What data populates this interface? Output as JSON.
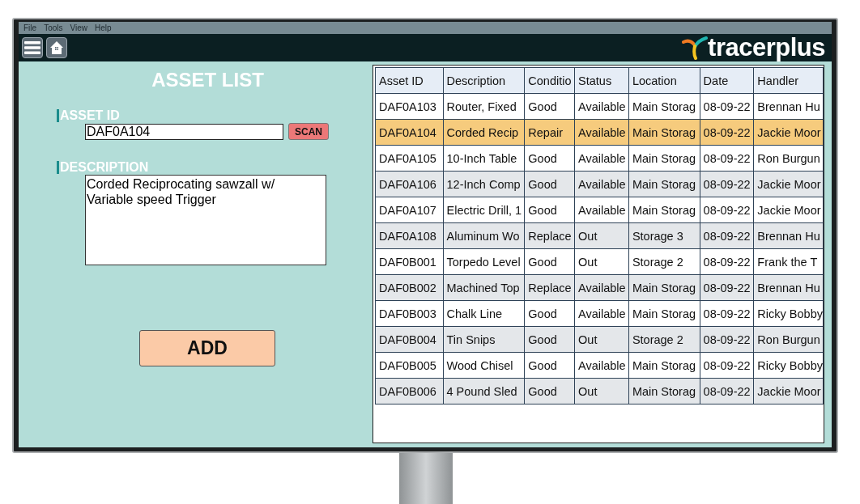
{
  "menu": [
    {
      "label": "File"
    },
    {
      "label": "Tools"
    },
    {
      "label": "View"
    },
    {
      "label": "Help"
    }
  ],
  "header": {
    "logo": "tracerplus"
  },
  "form": {
    "title": "ASSET LIST",
    "asset_id": {
      "label": "ASSET ID",
      "value": "DAF0A104"
    },
    "scan_button": "SCAN",
    "description": {
      "label": "DESCRIPTION",
      "value": "Corded Reciprocating sawzall w/ Variable speed Trigger"
    },
    "add_button": "ADD"
  },
  "table": {
    "columns": [
      "Asset ID",
      "Description",
      "Conditio",
      "Status",
      "Location",
      "Date",
      "Handler"
    ],
    "rows": [
      {
        "selected": false,
        "cells": [
          "DAF0A103",
          "Router, Fixed",
          "Good",
          "Available",
          "Main Storag",
          "08-09-22",
          "Brennan Hu"
        ]
      },
      {
        "selected": true,
        "cells": [
          "DAF0A104",
          "Corded Recip",
          "Repair",
          "Available",
          "Main Storag",
          "08-09-22",
          "Jackie Moor"
        ]
      },
      {
        "selected": false,
        "cells": [
          "DAF0A105",
          "10-Inch Table",
          "Good",
          "Available",
          "Main Storag",
          "08-09-22",
          "Ron Burgun"
        ]
      },
      {
        "selected": false,
        "cells": [
          "DAF0A106",
          "12-Inch Comp",
          "Good",
          "Available",
          "Main Storag",
          "08-09-22",
          "Jackie Moor"
        ]
      },
      {
        "selected": false,
        "cells": [
          "DAF0A107",
          "Electric Drill, 1",
          "Good",
          "Available",
          "Main Storag",
          "08-09-22",
          "Jackie Moor"
        ]
      },
      {
        "selected": false,
        "cells": [
          "DAF0A108",
          "Aluminum Wo",
          "Replace",
          "Out",
          "Storage 3",
          "08-09-22",
          "Brennan Hu"
        ]
      },
      {
        "selected": false,
        "cells": [
          "DAF0B001",
          "Torpedo Level",
          "Good",
          "Out",
          "Storage 2",
          "08-09-22",
          "Frank the T"
        ]
      },
      {
        "selected": false,
        "cells": [
          "DAF0B002",
          "Machined Top",
          "Replace",
          "Available",
          "Main Storag",
          "08-09-22",
          "Brennan Hu"
        ]
      },
      {
        "selected": false,
        "cells": [
          "DAF0B003",
          "Chalk Line",
          "Good",
          "Available",
          "Main Storag",
          "08-09-22",
          "Ricky Bobby"
        ]
      },
      {
        "selected": false,
        "cells": [
          "DAF0B004",
          "Tin Snips",
          "Good",
          "Out",
          "Storage 2",
          "08-09-22",
          "Ron Burgun"
        ]
      },
      {
        "selected": false,
        "cells": [
          "DAF0B005",
          "Wood Chisel",
          "Good",
          "Available",
          "Main Storag",
          "08-09-22",
          "Ricky Bobby"
        ]
      },
      {
        "selected": false,
        "cells": [
          "DAF0B006",
          "4 Pound Sled",
          "Good",
          "Out",
          "Main Storag",
          "08-09-22",
          "Jackie Moor"
        ]
      }
    ]
  }
}
